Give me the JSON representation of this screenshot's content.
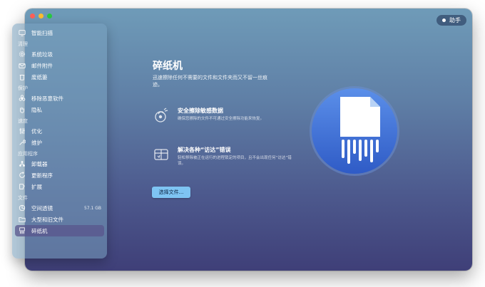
{
  "assistant": {
    "label": "助手"
  },
  "sidebar": {
    "items": [
      {
        "type": "item",
        "label": "智能扫描",
        "icon": "monitor-icon"
      },
      {
        "type": "section",
        "label": "清理"
      },
      {
        "type": "item",
        "label": "系统垃圾",
        "icon": "gear-icon"
      },
      {
        "type": "item",
        "label": "邮件附件",
        "icon": "mail-icon"
      },
      {
        "type": "item",
        "label": "废纸篓",
        "icon": "trash-icon"
      },
      {
        "type": "section",
        "label": "保护"
      },
      {
        "type": "item",
        "label": "移除恶意软件",
        "icon": "biohazard-icon"
      },
      {
        "type": "item",
        "label": "隐私",
        "icon": "hand-icon"
      },
      {
        "type": "section",
        "label": "速度"
      },
      {
        "type": "item",
        "label": "优化",
        "icon": "sliders-icon"
      },
      {
        "type": "item",
        "label": "维护",
        "icon": "wrench-icon"
      },
      {
        "type": "section",
        "label": "应用程序"
      },
      {
        "type": "item",
        "label": "卸载器",
        "icon": "uninstaller-icon"
      },
      {
        "type": "item",
        "label": "更新程序",
        "icon": "update-icon"
      },
      {
        "type": "item",
        "label": "扩展",
        "icon": "extension-icon"
      },
      {
        "type": "section",
        "label": "文件"
      },
      {
        "type": "item",
        "label": "空间透镜",
        "icon": "lens-icon",
        "meta": "57.1 GB"
      },
      {
        "type": "item",
        "label": "大型和旧文件",
        "icon": "folder-icon"
      },
      {
        "type": "item",
        "label": "碎纸机",
        "icon": "shredder-icon",
        "active": true
      }
    ]
  },
  "main": {
    "title": "碎纸机",
    "description": "迅速擦除任何不需要的文件和文件夹而又不留一丝痕迹。",
    "features": [
      {
        "title": "安全擦除敏感数据",
        "desc": "确保您擦除的文件不可通过安全擦除功能来恢复。",
        "icon": "secure-erase-icon"
      },
      {
        "title": "解决各种“访达”错误",
        "desc": "轻松移除被正在运行的进程锁定的项目，且不会出现任何“访达”错误。",
        "icon": "fix-errors-icon"
      }
    ],
    "choose_button": "选择文件..."
  },
  "colors": {
    "accent_button": "#7ec4f3",
    "hero_circle": "#3e6fd8"
  }
}
